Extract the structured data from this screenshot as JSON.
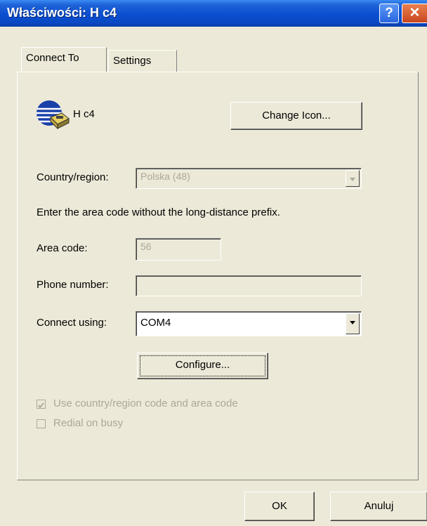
{
  "window": {
    "title": "Właściwości: H c4",
    "help": "?",
    "close": "✕"
  },
  "tabs": [
    {
      "label": "Connect To"
    },
    {
      "label": "Settings"
    }
  ],
  "connection": {
    "name": "H c4"
  },
  "buttons": {
    "change_icon": "Change Icon...",
    "configure": "Configure...",
    "ok": "OK",
    "cancel": "Anuluj"
  },
  "form": {
    "country_label": "Country/region:",
    "country_value": "Polska (48)",
    "instruction": "Enter the area code without the long-distance prefix.",
    "area_code_label": "Area code:",
    "area_code_value": "56",
    "phone_label": "Phone number:",
    "phone_value": "",
    "connect_label": "Connect using:",
    "connect_value": "COM4"
  },
  "checkboxes": {
    "use_country": {
      "label": "Use country/region code and area code",
      "checked": true
    },
    "redial": {
      "label": "Redial on busy",
      "checked": false
    }
  }
}
